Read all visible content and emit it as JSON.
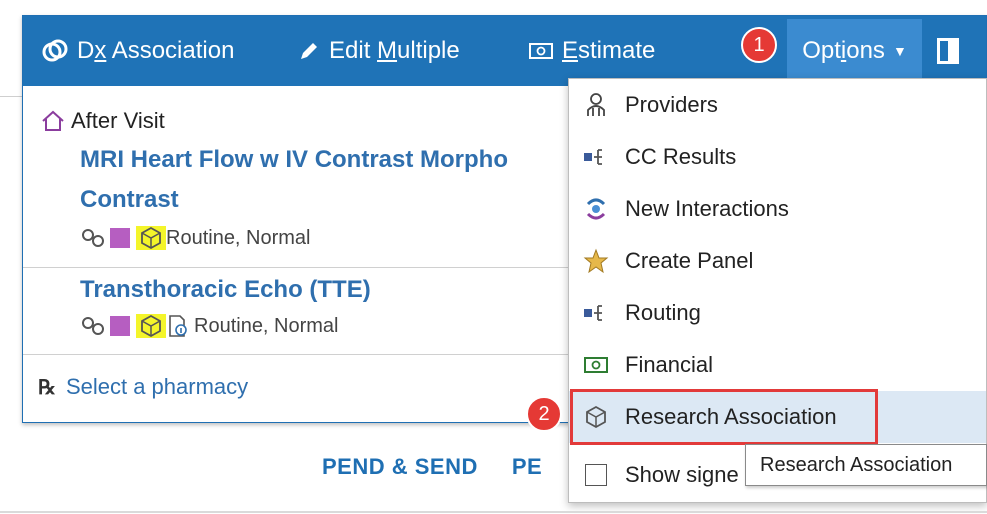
{
  "toolbar": {
    "dx_association": {
      "pre": "D",
      "underline": "x",
      "post": " Association"
    },
    "edit_multiple": {
      "pre": "Edit ",
      "underline": "M",
      "post": "ultiple"
    },
    "estimate": {
      "pre": "",
      "underline": "E",
      "post": "stimate"
    },
    "options": {
      "pre": "Opt",
      "underline": "i",
      "post": "ons"
    }
  },
  "content": {
    "section_label": "After Visit",
    "orders": [
      {
        "title_line1": "MRI Heart Flow w IV Contrast Morpho",
        "title_line2": "Contrast",
        "meta": "Routine, Normal"
      },
      {
        "title_line1": "Transthoracic Echo (TTE)",
        "meta": "Routine, Normal"
      }
    ],
    "pharmacy": {
      "rx": "℞",
      "label": "Select a pharmacy"
    }
  },
  "bottom_actions": {
    "pend_send": "PEND & SEND",
    "pend_partial": "PE"
  },
  "menu": {
    "items": [
      {
        "label": "Providers",
        "icon": "providers-icon"
      },
      {
        "label": "CC Results",
        "icon": "cc-results-icon"
      },
      {
        "label": "New Interactions",
        "icon": "new-interactions-icon"
      },
      {
        "label": "Create Panel",
        "icon": "star-icon"
      },
      {
        "label": "Routing",
        "icon": "routing-icon"
      },
      {
        "label": "Financial",
        "icon": "financial-icon"
      },
      {
        "label": "Research Association",
        "icon": "research-icon"
      },
      {
        "label": "Show signe",
        "icon": "checkbox"
      }
    ]
  },
  "tooltip": "Research Association",
  "badges": {
    "one": "1",
    "two": "2"
  },
  "colors": {
    "toolbar": "#1f73b7",
    "options_active": "#3b8bd0",
    "link": "#2f6fae",
    "highlight": "#f4f52a",
    "callout": "#e53935"
  }
}
